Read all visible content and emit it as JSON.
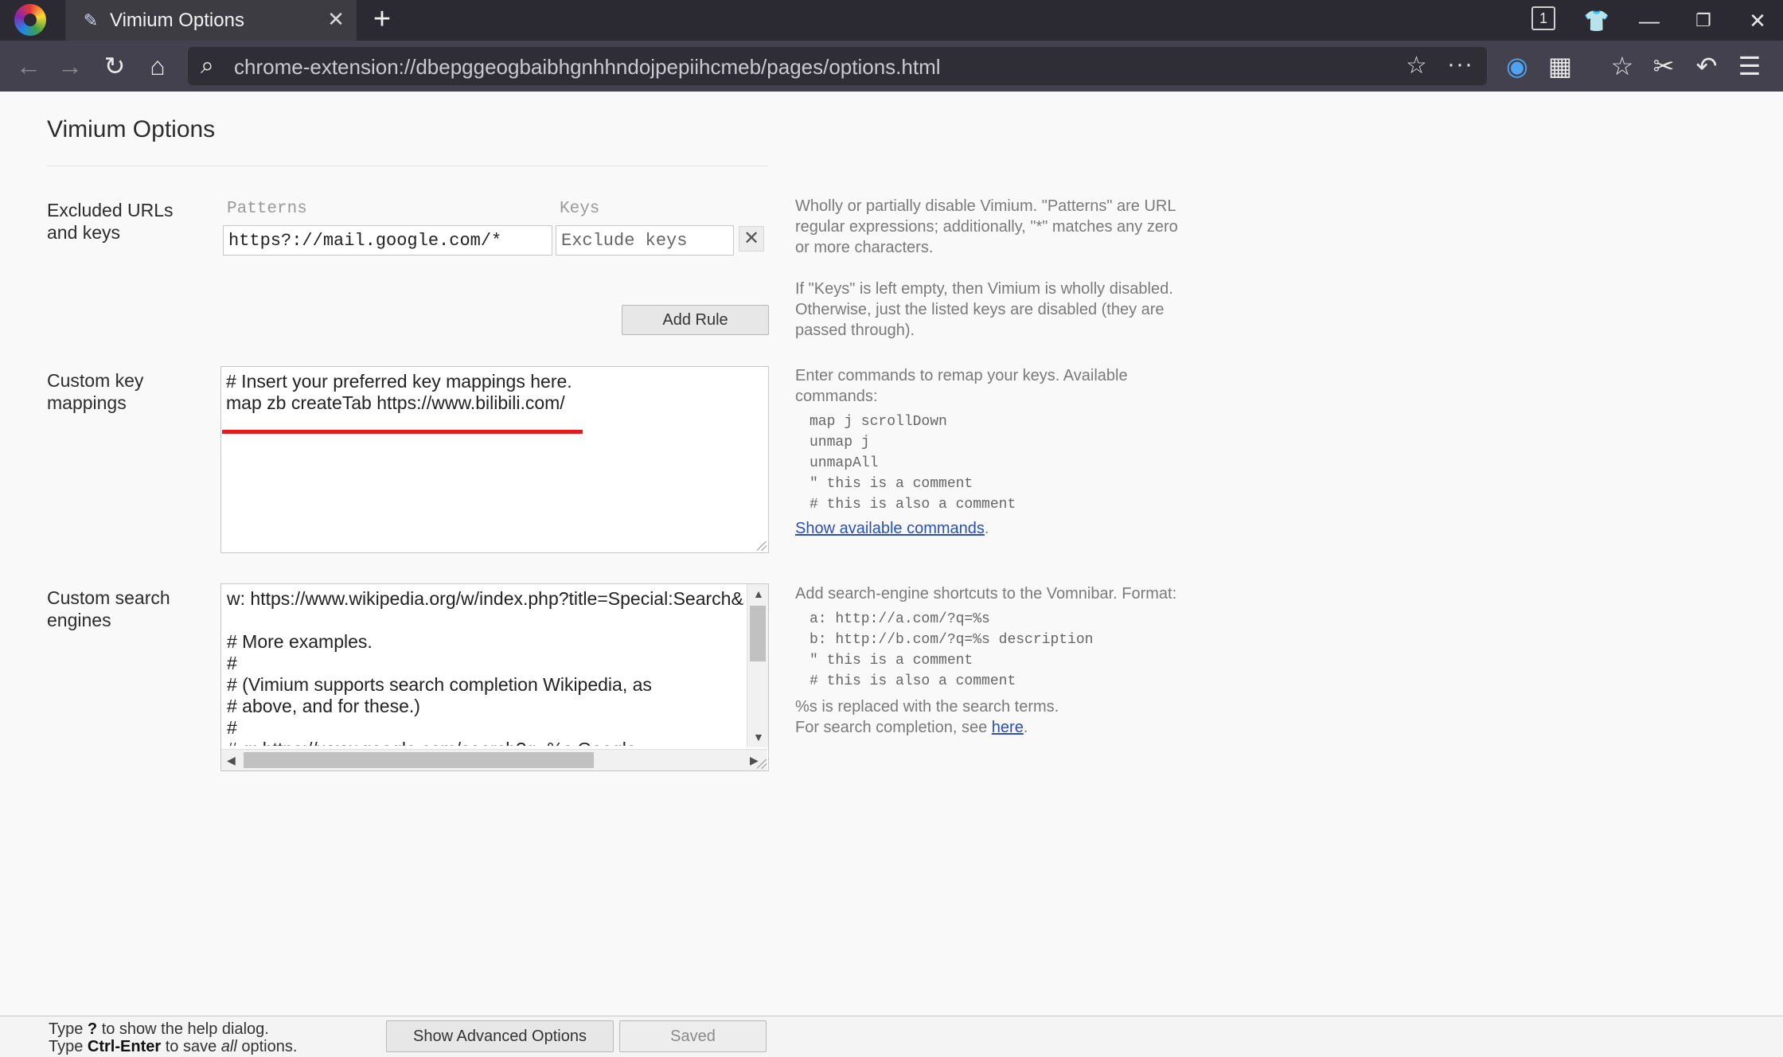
{
  "browser": {
    "tab_title": "Vimium Options",
    "tab_count": "1",
    "url": "chrome-extension://dbepggeogbaibhgnhhndojpepiihcmeb/pages/options.html"
  },
  "page": {
    "title": "Vimium Options"
  },
  "excluded": {
    "label_line1": "Excluded URLs",
    "label_line2": "and keys",
    "patterns_header": "Patterns",
    "keys_header": "Keys",
    "pattern_value": "https?://mail.google.com/*",
    "keys_placeholder": "Exclude keys",
    "add_rule": "Add Rule",
    "help1": "Wholly or partially disable Vimium. \"Patterns\" are URL regular expressions; additionally, \"*\" matches any zero or more characters.",
    "help2": "If \"Keys\" is left empty, then Vimium is wholly disabled. Otherwise, just the listed keys are disabled (they are passed through)."
  },
  "key_mappings": {
    "label_line1": "Custom key",
    "label_line2": "mappings",
    "lines": [
      "# Insert your preferred key mappings here.",
      "map zb createTab https://www.bilibili.com/"
    ],
    "help_intro": "Enter commands to remap your keys. Available commands:",
    "examples": "map j scrollDown\nunmap j\nunmapAll\n\" this is a comment\n# this is also a comment",
    "help_link": "Show available commands",
    "help_link_suffix": "."
  },
  "search_engines": {
    "label_line1": "Custom search",
    "label_line2": "engines",
    "lines": [
      "w: https://www.wikipedia.org/w/index.php?title=Special:Search&search=%s Wikipedia",
      "",
      "# More examples.",
      "#",
      "# (Vimium supports search completion Wikipedia, as",
      "# above, and for these.)",
      "#",
      "# g: https://www.google.com/search?q=%s Google"
    ],
    "help_intro": "Add search-engine shortcuts to the Vomnibar. Format:",
    "examples": "a: http://a.com/?q=%s\nb: http://b.com/?q=%s description\n\" this is a comment\n# this is also a comment",
    "help_line1": "%s is replaced with the search terms.",
    "help_line2_prefix": "For search completion, see ",
    "help_link": "here",
    "help_link_suffix": "."
  },
  "footer": {
    "line1_a": "Type ",
    "line1_key": "?",
    "line1_b": " to show the help dialog.",
    "line2_a": "Type ",
    "line2_key": "Ctrl-Enter",
    "line2_b": " to save ",
    "line2_em": "all",
    "line2_c": " options.",
    "advanced_button": "Show Advanced Options",
    "saved_button": "Saved"
  }
}
